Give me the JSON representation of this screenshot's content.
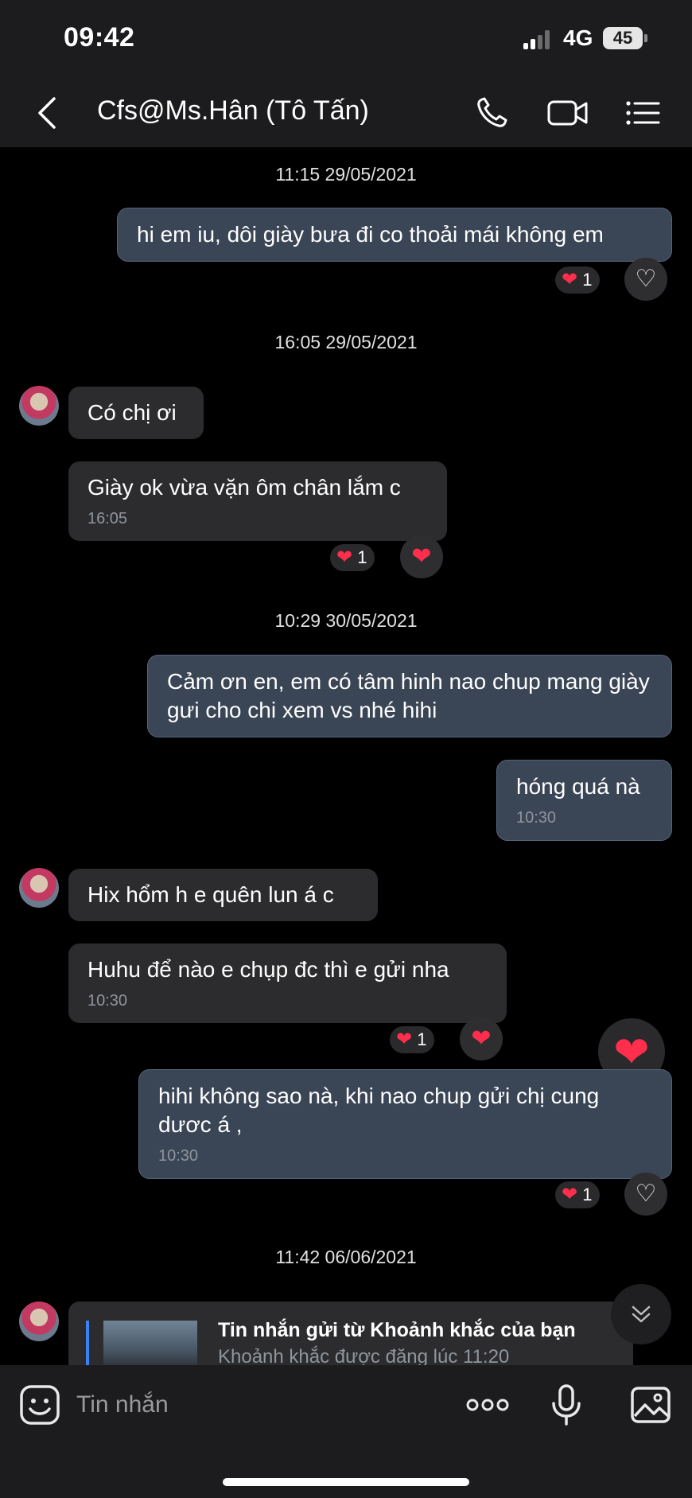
{
  "status": {
    "time": "09:42",
    "network": "4G",
    "battery": "45"
  },
  "header": {
    "title": "Cfs@Ms.Hân (Tô Tấn)"
  },
  "stamps": [
    "11:15 29/05/2021",
    "16:05 29/05/2021",
    "10:29 30/05/2021",
    "11:42 06/06/2021"
  ],
  "messages": [
    {
      "text": "hi em iu, dôi giày bưa đi co thoải mái không em"
    },
    {
      "text": "Có chị ơi"
    },
    {
      "text": "Giày ok vừa vặn ôm chân lắm c",
      "time": "16:05"
    },
    {
      "text": "Cảm ơn en, em có tâm hinh nao chup mang giày gưi cho chi xem vs nhé hihi"
    },
    {
      "text": "hóng quá nà",
      "time": "10:30"
    },
    {
      "text": "Hix hổm h e quên lun á c"
    },
    {
      "text": "Huhu để nào e chụp đc thì e gửi nha",
      "time": "10:30"
    },
    {
      "text": "hihi không sao nà, khi nao chup gửi chị cung dươc á ,",
      "time": "10:30"
    }
  ],
  "reactions": {
    "count": "1",
    "heart": "❤",
    "heart_outline": "♡"
  },
  "moment_card": {
    "title": "Tin nhắn gửi từ Khoảnh khắc của bạn",
    "subtitle": "Khoảnh khắc được đăng lúc 11:20"
  },
  "composer": {
    "placeholder": "Tin nhắn"
  },
  "icons": [
    "back-icon",
    "phone-icon",
    "video-call-icon",
    "menu-icon",
    "sticker-icon",
    "more-icon",
    "microphone-icon",
    "image-icon",
    "chevron-double-down-icon"
  ],
  "colors": {
    "outgoing_bubble": "#3a4555",
    "incoming_bubble": "#2c2c2e",
    "heart": "#ff2e4c"
  }
}
